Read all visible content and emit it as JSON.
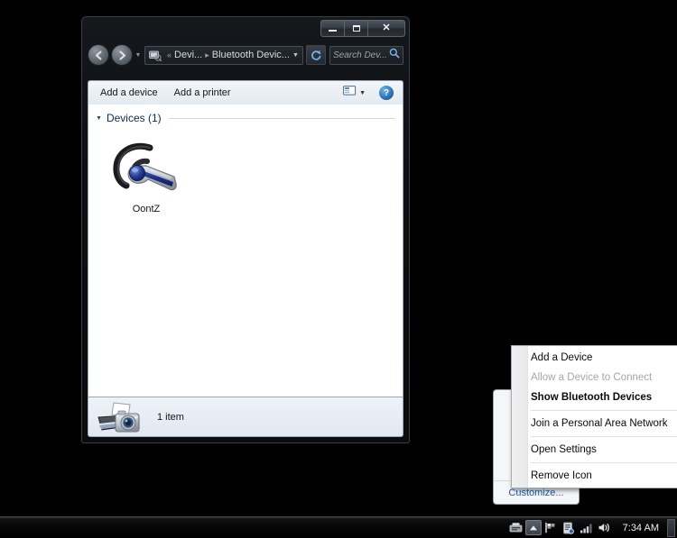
{
  "window": {
    "title": "",
    "controls": {
      "minimize": "minimize-button",
      "maximize": "maximize-button",
      "close": "close-button",
      "close_glyph": "✕"
    },
    "nav": {
      "back_glyph": "←",
      "forward_glyph": "→",
      "recent_caret": "▼"
    },
    "address": {
      "overflow": "«",
      "crumb1": "Devi...",
      "separator": "▸",
      "crumb2": "Bluetooth Devic...",
      "dropdown_caret": "▼",
      "refresh_label": "↻"
    },
    "search": {
      "placeholder": "Search Dev...",
      "icon": "search-icon"
    },
    "commandbar": {
      "add_device": "Add a device",
      "add_printer": "Add a printer",
      "view_caret": "▼",
      "help_label": "?"
    },
    "content": {
      "group_arrow": "▼",
      "group_label": "Devices (1)",
      "items": [
        {
          "label": "OontZ",
          "icon": "bluetooth-headset-icon"
        }
      ]
    },
    "status": {
      "icon": "devices-printer-camera-icon",
      "text": "1 item"
    }
  },
  "notification_popup": {
    "icons": [
      "tray-overflow-icon-1",
      "bluetooth-icon"
    ],
    "customize_label": "Customize..."
  },
  "context_menu": {
    "items": [
      {
        "label": "Add a Device",
        "state": "normal",
        "separator_after": false
      },
      {
        "label": "Allow a Device to Connect",
        "state": "disabled",
        "separator_after": false
      },
      {
        "label": "Show Bluetooth Devices",
        "state": "bold",
        "separator_after": true
      },
      {
        "label": "Join a Personal Area Network",
        "state": "normal",
        "separator_after": true
      },
      {
        "label": "Open Settings",
        "state": "normal",
        "separator_after": true
      },
      {
        "label": "Remove Icon",
        "state": "normal",
        "separator_after": false
      }
    ]
  },
  "taskbar": {
    "tray_icons": [
      {
        "name": "removable-media-icon"
      },
      {
        "name": "show-hidden-icons-arrow",
        "active": true
      },
      {
        "name": "flag-action-center-icon"
      },
      {
        "name": "network-sharing-icon"
      },
      {
        "name": "network-signal-icon"
      },
      {
        "name": "volume-speaker-icon"
      }
    ],
    "clock": "7:34 AM",
    "show_desktop": "show-desktop-button"
  },
  "colors": {
    "desktop_bg": "#000000",
    "window_chrome": "#13161a",
    "content_bg": "#ffffff",
    "accent_link": "#1a5fa8",
    "group_label": "#0d2a4a"
  }
}
